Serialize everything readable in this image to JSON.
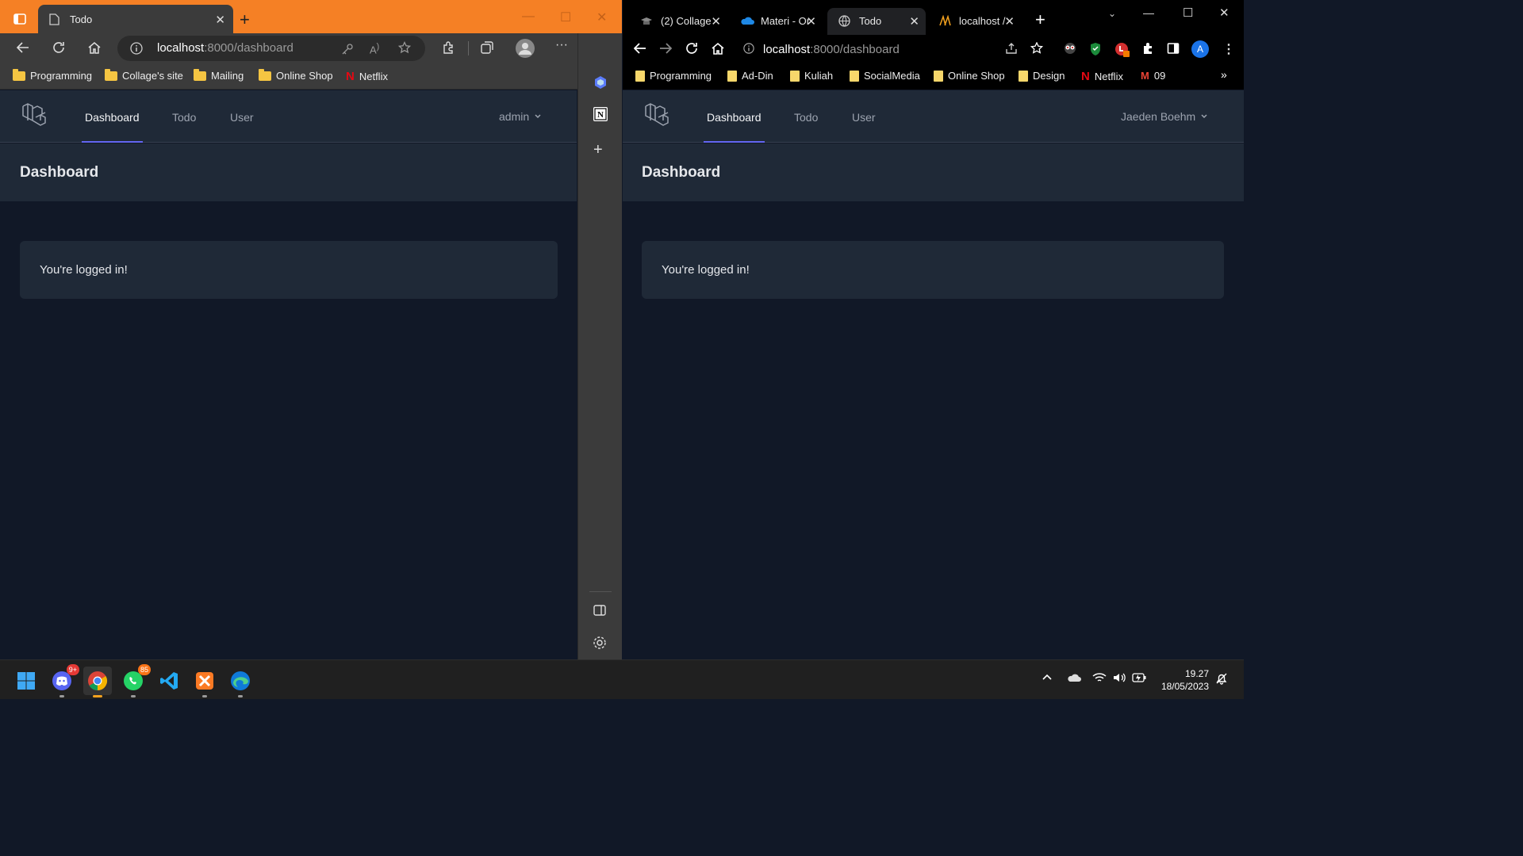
{
  "left_browser": {
    "tab_title": "Todo",
    "url_host": "localhost",
    "url_path": ":8000/dashboard",
    "bookmarks": [
      "Programming",
      "Collage's site",
      "Mailing",
      "Online Shop",
      "Netflix"
    ]
  },
  "right_browser": {
    "tabs": [
      "(2) Collage",
      "Materi - Or",
      "Todo",
      "localhost /"
    ],
    "url_host": "localhost",
    "url_path": ":8000/dashboard",
    "bookmarks": [
      "Programming",
      "Ad-Din",
      "Kuliah",
      "SocialMedia",
      "Online Shop",
      "Design",
      "Netflix",
      "09"
    ],
    "profile_initial": "A"
  },
  "left_app": {
    "nav": [
      "Dashboard",
      "Todo",
      "User"
    ],
    "user": "admin",
    "header": "Dashboard",
    "message": "You're logged in!"
  },
  "right_app": {
    "nav": [
      "Dashboard",
      "Todo",
      "User"
    ],
    "user": "Jaeden Boehm",
    "header": "Dashboard",
    "message": "You're logged in!"
  },
  "taskbar": {
    "discord_badge": "9+",
    "whatsapp_badge": "85",
    "time": "19.27",
    "date": "18/05/2023"
  },
  "colors": {
    "edge_titlebar": "#f58025",
    "nav_active_underline": "#6366f1",
    "page_bg": "#111827",
    "panel_bg": "#1f2937"
  }
}
